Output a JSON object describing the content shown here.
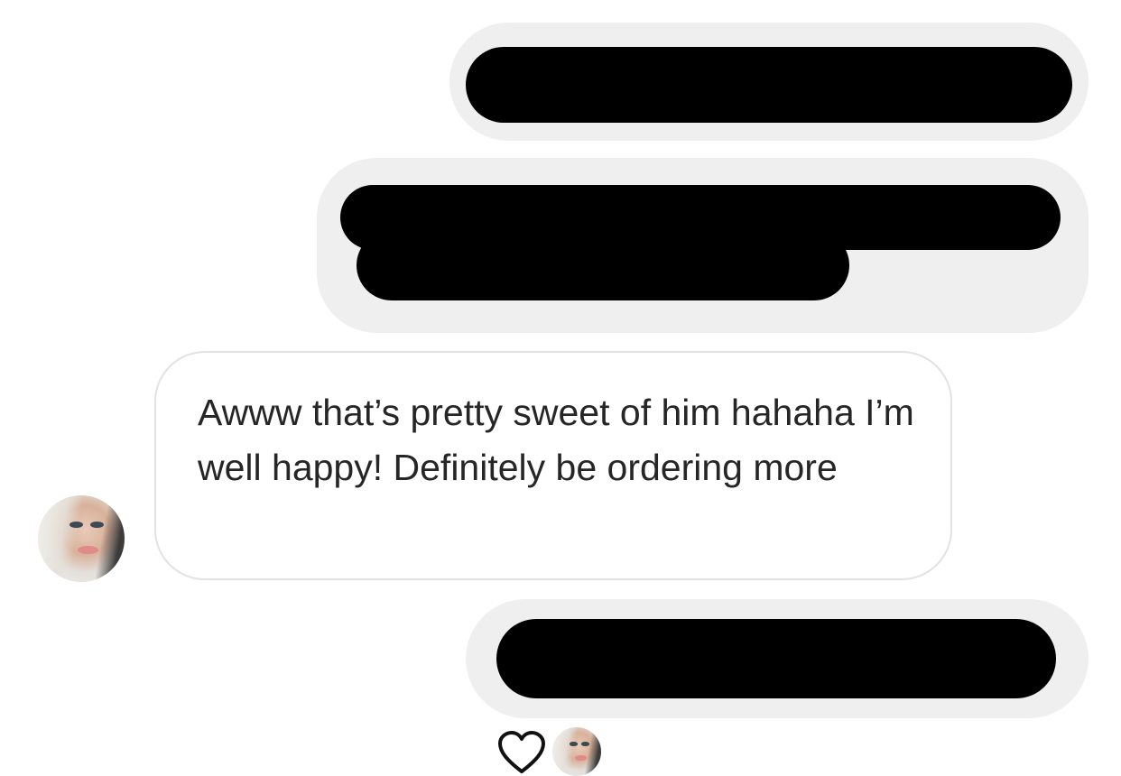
{
  "conversation": {
    "outgoing_messages": [
      {
        "text": "",
        "redacted": true
      },
      {
        "text": "",
        "redacted": true
      },
      {
        "text": "",
        "redacted": true
      }
    ],
    "incoming_message": {
      "text": "Awww that’s pretty sweet of him hahaha I’m well happy! Definitely be ordering more"
    },
    "reaction": {
      "icon": "heart-outline-icon"
    }
  },
  "colors": {
    "outgoing_bubble": "#efefef",
    "incoming_border": "#e2e2e2",
    "text": "#262626",
    "redaction": "#000000"
  }
}
